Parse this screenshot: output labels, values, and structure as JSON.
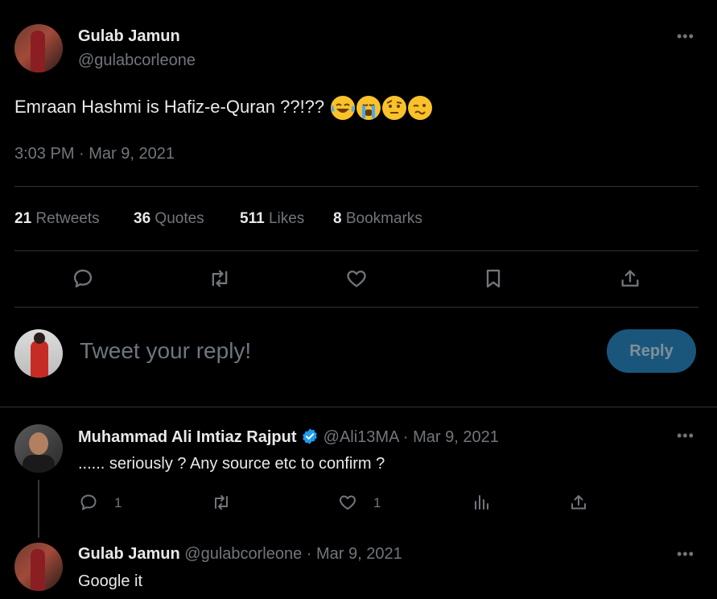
{
  "tweet": {
    "author_name": "Gulab Jamun",
    "author_handle": "@gulabcorleone",
    "text": "Emraan Hashmi is Hafiz-e-Quran ??!??",
    "emojis": [
      "face-with-tears-of-joy",
      "loudly-crying-face",
      "face-with-raised-eyebrow",
      "woozy-face"
    ],
    "timestamp": "3:03 PM · Mar 9, 2021",
    "stats": {
      "retweets_count": "21",
      "retweets_label": "Retweets",
      "quotes_count": "36",
      "quotes_label": "Quotes",
      "likes_count": "511",
      "likes_label": "Likes",
      "bookmarks_count": "8",
      "bookmarks_label": "Bookmarks"
    },
    "more": "•••"
  },
  "composer": {
    "placeholder": "Tweet your reply!",
    "reply_label": "Reply"
  },
  "replies": [
    {
      "author_name": "Muhammad Ali Imtiaz Rajput",
      "verified": true,
      "author_handle": "@Ali13MA",
      "date": "· Mar 9, 2021",
      "text": "...... seriously ? Any source etc to confirm ?",
      "reply_count": "1",
      "like_count": "1",
      "more": "•••"
    },
    {
      "author_name": "Gulab Jamun",
      "author_handle": "@gulabcorleone",
      "date": "· Mar 9, 2021",
      "text": "Google it",
      "more": "•••"
    }
  ],
  "colors": {
    "background": "#000000",
    "text": "#e7e9ea",
    "muted": "#71767b",
    "verified": "#1d9bf0",
    "reply_button": "#1a567c"
  }
}
